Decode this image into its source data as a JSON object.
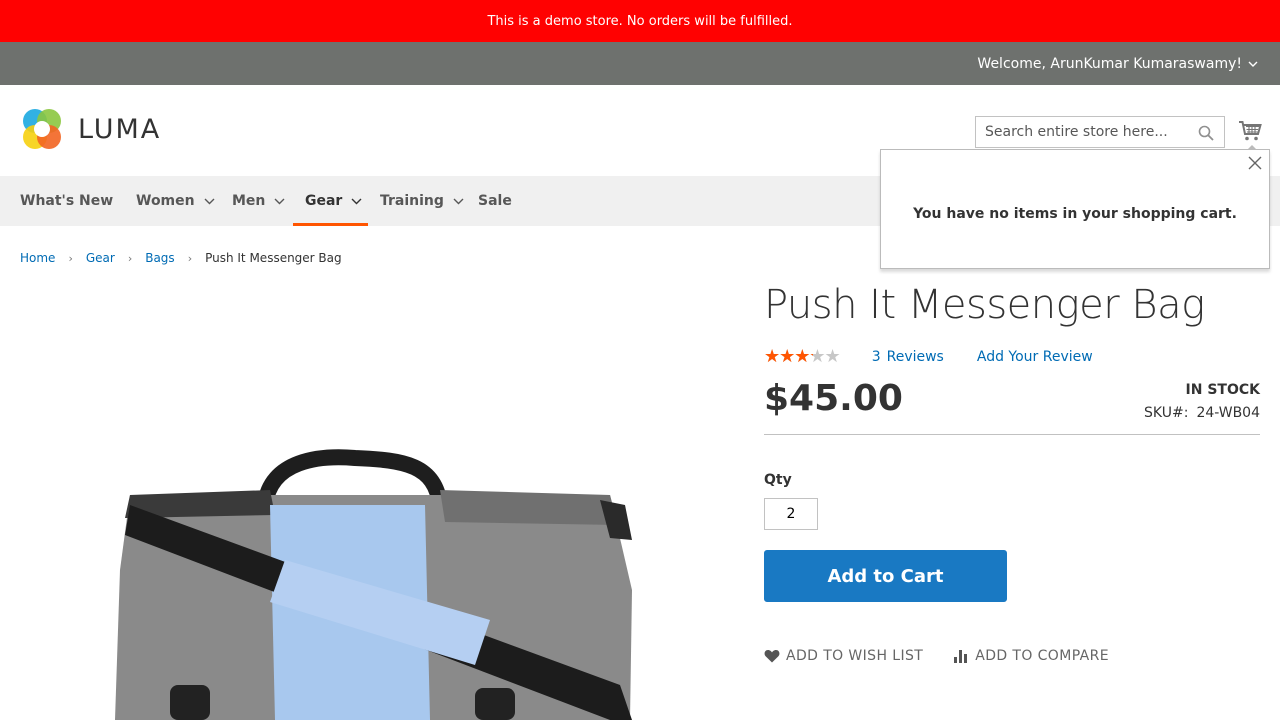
{
  "demo_notice": "This is a demo store. No orders will be fulfilled.",
  "top_bar": {
    "welcome": "Welcome, ArunKumar Kumaraswamy!"
  },
  "header": {
    "logo_text": "LUMA",
    "search_placeholder": "Search entire store here..."
  },
  "nav": {
    "items": [
      {
        "label": "What's New"
      },
      {
        "label": "Women"
      },
      {
        "label": "Men"
      },
      {
        "label": "Gear"
      },
      {
        "label": "Training"
      },
      {
        "label": "Sale"
      }
    ],
    "active": "Gear"
  },
  "minicart": {
    "message": "You have no items in your shopping cart."
  },
  "breadcrumb": {
    "items": [
      {
        "label": "Home"
      },
      {
        "label": "Gear"
      },
      {
        "label": "Bags"
      },
      {
        "label": "Push It Messenger Bag"
      }
    ]
  },
  "product": {
    "title": "Push It Messenger Bag",
    "rating_fraction": 0.65,
    "review_count": "3",
    "reviews_label": "Reviews",
    "add_review_label": "Add Your Review",
    "price": "$45.00",
    "stock": "In stock",
    "sku_label": "SKU#:",
    "sku": "24-WB04",
    "qty_label": "Qty",
    "qty_value": "2",
    "add_to_cart_label": "Add to Cart",
    "wishlist_label": "Add to Wish List",
    "compare_label": "Add to Compare"
  },
  "colors": {
    "demo_bar": "#ff0101",
    "top_bar": "#6e716e",
    "accent": "#ff5501",
    "button": "#1979c3",
    "link": "#006bb4"
  },
  "icons": [
    "chevron-down-icon",
    "search-icon",
    "cart-icon",
    "close-icon",
    "star-icon",
    "heart-icon",
    "compare-icon"
  ]
}
